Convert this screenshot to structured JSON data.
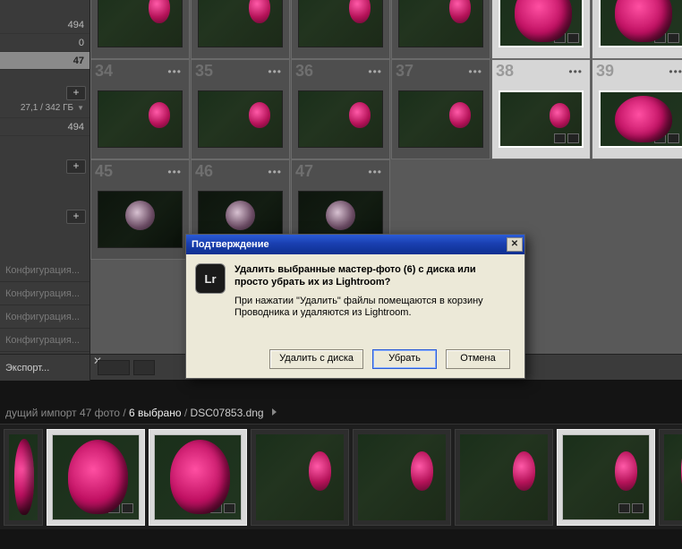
{
  "sidebar": {
    "stats": [
      "494",
      "0",
      "47"
    ],
    "disk": "27,1 / 342 ГБ",
    "count_under_disk": "494",
    "config_items": [
      "Конфигурация...",
      "Конфигурация...",
      "Конфигурация...",
      "Конфигурация..."
    ],
    "export_label": "Экспорт..."
  },
  "grid": {
    "row1_numbers": [
      "34",
      "35",
      "36",
      "37",
      "38",
      "39"
    ],
    "row2_numbers": [
      "45",
      "46",
      "47"
    ]
  },
  "breadcrumb": {
    "prefix": "дущий импорт  47 фото",
    "selected": "6 выбрано",
    "filename": "DSC07853.dng"
  },
  "dialog": {
    "title": "Подтверждение",
    "icon_text": "Lr",
    "message": "Удалить выбранные мастер-фото (6) с диска или просто убрать их из Lightroom?",
    "info": "При нажатии \"Удалить\" файлы помещаются в корзину Проводника и удаляются из Lightroom.",
    "btn_delete": "Удалить с диска",
    "btn_remove": "Убрать",
    "btn_cancel": "Отмена"
  }
}
